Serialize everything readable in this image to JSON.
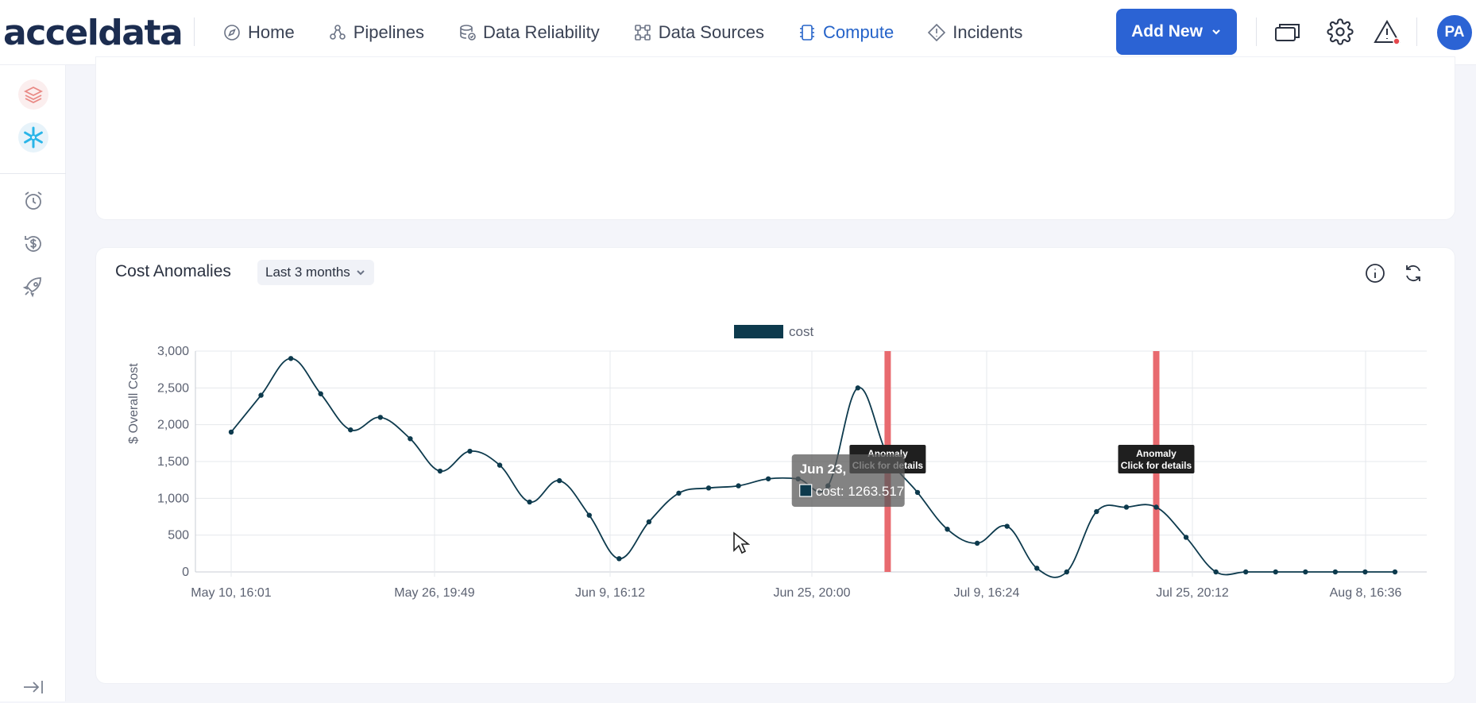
{
  "brand": {
    "logo": "acceldata"
  },
  "nav": {
    "items": [
      {
        "label": "Home",
        "icon": "compass-icon"
      },
      {
        "label": "Pipelines",
        "icon": "pipelines-icon"
      },
      {
        "label": "Data Reliability",
        "icon": "database-check-icon"
      },
      {
        "label": "Data Sources",
        "icon": "data-sources-icon"
      },
      {
        "label": "Compute",
        "icon": "chip-icon",
        "active": true
      },
      {
        "label": "Incidents",
        "icon": "diamond-alert-icon"
      }
    ],
    "add_new_label": "Add New",
    "avatar_initials": "PA"
  },
  "colors": {
    "accent": "#2b63d4",
    "line": "#0d3a4d",
    "anomaly": "#e86a6f",
    "alert_dot": "#e5484d"
  },
  "card": {
    "title": "Cost Anomalies",
    "range_label": "Last 3 months"
  },
  "chart_data": {
    "type": "line",
    "legend": [
      "cost"
    ],
    "ylabel": "$ Overall Cost",
    "ylim": [
      0,
      3000
    ],
    "yticks": [
      "3,000",
      "2,500",
      "2,000",
      "1,500",
      "1,000",
      "500",
      "0"
    ],
    "xticks": [
      "May 10, 16:01",
      "May 26, 19:49",
      "Jun 9, 16:12",
      "Jun 25, 20:00",
      "Jul 9, 16:24",
      "Jul 25, 20:12",
      "Aug 8, 16:36"
    ],
    "series": [
      {
        "name": "cost",
        "values": [
          1900,
          2400,
          2900,
          2420,
          1930,
          2100,
          1810,
          1370,
          1640,
          1450,
          950,
          1240,
          770,
          180,
          680,
          1070,
          1140,
          1170,
          1265,
          1263.517,
          1170,
          2500,
          1580,
          1080,
          580,
          390,
          620,
          50,
          0,
          820,
          880,
          880,
          470,
          0,
          0,
          0,
          0,
          0,
          0,
          0
        ]
      }
    ],
    "anomalies": [
      {
        "index": 22,
        "label_line1": "Anomaly",
        "label_line2": "Click for details"
      },
      {
        "index": 31,
        "label_line1": "Anomaly",
        "label_line2": "Click for details"
      }
    ],
    "tooltip": {
      "title": "Jun 23,",
      "text": "cost: 1263.517",
      "index": 19
    }
  }
}
